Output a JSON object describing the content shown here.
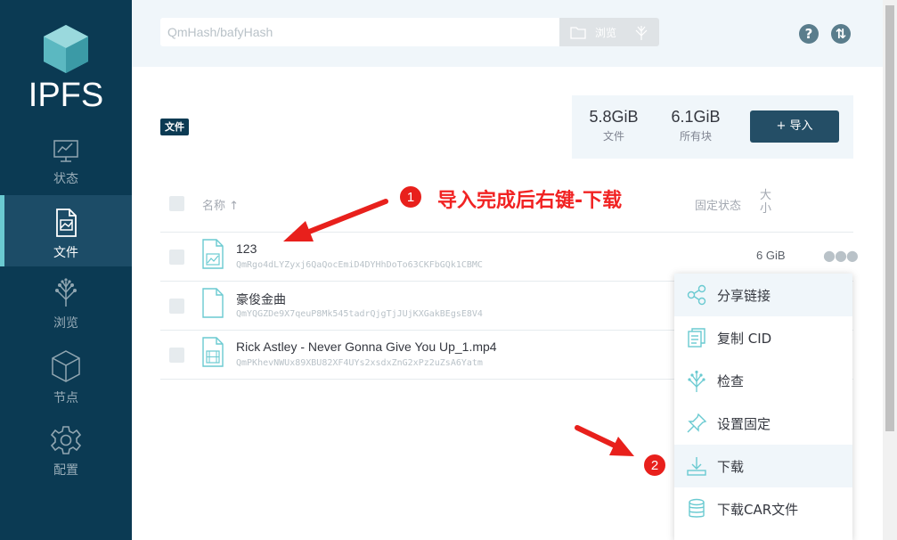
{
  "brand": {
    "logo_text": "IPFS"
  },
  "sidebar": {
    "items": [
      {
        "label": "状态",
        "icon": "status-chart-icon",
        "active": false
      },
      {
        "label": "文件",
        "icon": "files-icon",
        "active": true
      },
      {
        "label": "浏览",
        "icon": "explore-tree-icon",
        "active": false
      },
      {
        "label": "节点",
        "icon": "peers-cube-icon",
        "active": false
      },
      {
        "label": "配置",
        "icon": "settings-gear-icon",
        "active": false
      }
    ]
  },
  "header": {
    "search_placeholder": "QmHash/bafyHash",
    "browse_label": "浏览",
    "help_glyph": "?",
    "sync_glyph": "⇅"
  },
  "files": {
    "section_tag": "文件",
    "stats": [
      {
        "value": "5.8GiB",
        "label": "文件"
      },
      {
        "value": "6.1GiB",
        "label": "所有块"
      }
    ],
    "import_label": "+ 导入",
    "columns": {
      "name": "名称 ↑",
      "pin_status": "固定状态",
      "size": "大小"
    },
    "rows": [
      {
        "name": "123",
        "cid": "QmRgo4dLYZyxj6QaQocEmiD4DYHhDoTo63CKFbGQk1CBMC",
        "size": "6 GiB",
        "type": "chart-file"
      },
      {
        "name": "豪俊金曲",
        "cid": "QmYQGZDe9X7qeuP8Mk545tadrQjgTjJUjKXGakBEgsE8V4",
        "size": "",
        "type": "doc-file"
      },
      {
        "name": "Rick Astley - Never Gonna Give You Up_1.mp4",
        "cid": "QmPKhevNWUx89XBU82XF4UYs2xsdxZnG2xPz2uZsA6Yatm",
        "size": "",
        "type": "video-file"
      }
    ]
  },
  "context_menu": {
    "items": [
      {
        "label": "分享链接",
        "icon": "share-icon",
        "highlighted": true
      },
      {
        "label": "复制 CID",
        "icon": "copy-icon",
        "highlighted": false
      },
      {
        "label": "检查",
        "icon": "inspect-tree-icon",
        "highlighted": false
      },
      {
        "label": "设置固定",
        "icon": "pin-icon",
        "highlighted": false
      },
      {
        "label": "下载",
        "icon": "download-icon",
        "highlighted": true
      },
      {
        "label": "下载CAR文件",
        "icon": "database-icon",
        "highlighted": false
      }
    ]
  },
  "annotations": {
    "step1_number": "1",
    "step1_text": "导入完成后右键-下载",
    "step2_number": "2",
    "color": "#e8201c"
  },
  "colors": {
    "sidebar_bg": "#0b3a53",
    "accent_teal": "#6acad1",
    "import_button": "#244e66",
    "header_bg": "#f0f6fa"
  }
}
